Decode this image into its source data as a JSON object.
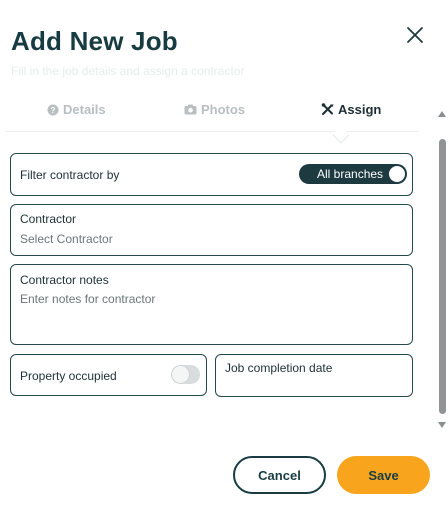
{
  "dialog": {
    "title": "Add New Job",
    "subtitle": "Fill in the job details and assign a contractor",
    "close_icon": "close-icon"
  },
  "tabs": [
    {
      "label": "Details",
      "icon": "question-circle-icon",
      "active": false
    },
    {
      "label": "Photos",
      "icon": "camera-icon",
      "active": false
    },
    {
      "label": "Assign",
      "icon": "tools-icon",
      "active": true
    }
  ],
  "form": {
    "filter": {
      "label": "Filter contractor by",
      "toggle_label": "All branches",
      "on": true
    },
    "contractor": {
      "label": "Contractor",
      "placeholder": "Select Contractor"
    },
    "notes": {
      "label": "Contractor notes",
      "placeholder": "Enter notes for contractor"
    },
    "property_occupied": {
      "label": "Property occupied",
      "on": false
    },
    "completion_date": {
      "label": "Job completion date",
      "value": ""
    }
  },
  "buttons": {
    "cancel": "Cancel",
    "save": "Save"
  },
  "colors": {
    "primary": "#183c42",
    "accent": "#f8a51d",
    "inactive_tab": "#b9bfc1",
    "toggle_off": "#d8dcdd"
  }
}
